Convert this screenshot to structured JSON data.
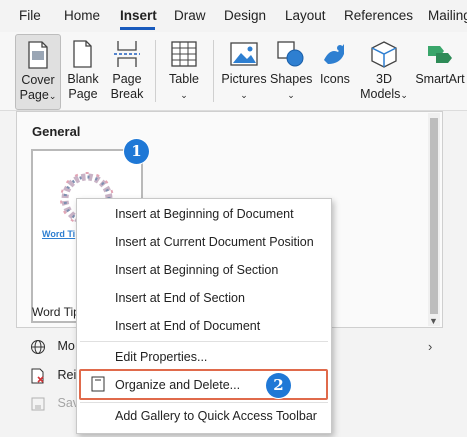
{
  "tabs": [
    "File",
    "Home",
    "Insert",
    "Draw",
    "Design",
    "Layout",
    "References",
    "Mailing"
  ],
  "ribbon": {
    "cover_page": [
      "Cover",
      "Page"
    ],
    "blank_page": [
      "Blank",
      "Page"
    ],
    "page_break": [
      "Page",
      "Break"
    ],
    "table": "Table",
    "pictures": "Pictures",
    "shapes": "Shapes",
    "icons": "Icons",
    "models": [
      "3D",
      "Models"
    ],
    "smartart": "SmartArt"
  },
  "gallery": {
    "section_title": "General",
    "thumbnail_text": "Word Ti",
    "thumbnail_caption": "Word Tip"
  },
  "lower_menu": [
    "Mo",
    "Rei",
    "Sav"
  ],
  "context_menu": {
    "items": [
      "Insert at Beginning of Document",
      "Insert at Current Document Position",
      "Insert at Beginning of Section",
      "Insert at End of Section",
      "Insert at End of Document",
      "Edit Properties...",
      "Organize and Delete...",
      "Add Gallery to Quick Access Toolbar"
    ]
  },
  "badges": [
    "1",
    "2"
  ],
  "colors": {
    "accent_blue": "#185abd",
    "badge_blue": "#1f78d6",
    "highlight_border": "#e06a4b"
  }
}
